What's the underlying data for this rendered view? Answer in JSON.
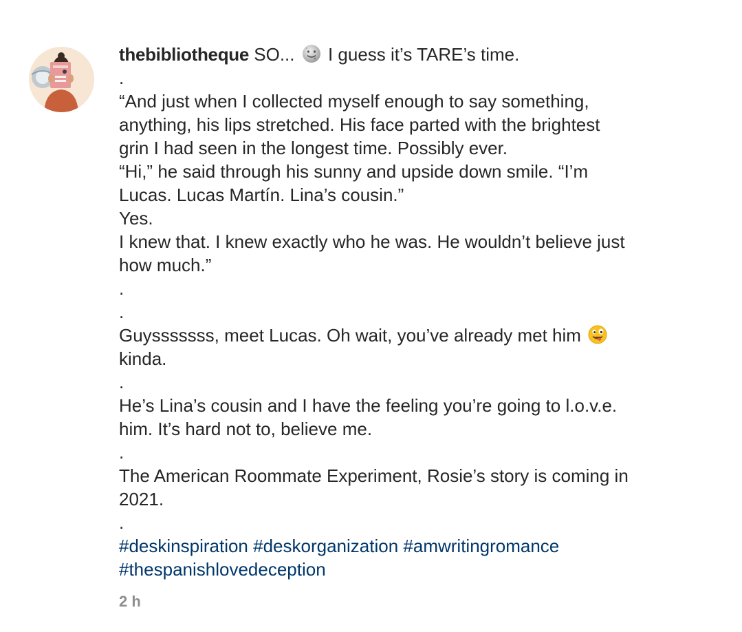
{
  "comment": {
    "username": "thebibliotheque",
    "first_line_pre_emoji": " SO... ",
    "first_line_post_emoji": " I guess it’s TARE’s time.",
    "emoji_1": "moon-face-icon",
    "emoji_2": "winking-tongue-face-icon",
    "lines": [
      ".",
      "“And just when I collected myself enough to say something,",
      "anything, his lips stretched. His face parted with the brightest",
      "grin I had seen in the longest time. Possibly ever.",
      "“Hi,” he said through his sunny and upside down smile. “I’m",
      "Lucas. Lucas Martín. Lina’s cousin.”",
      "Yes.",
      "I knew that. I knew exactly who he was. He wouldn’t believe just",
      "how much.”",
      ".",
      "."
    ],
    "guys_line_pre_emoji": "Guysssssss, meet Lucas. Oh wait, you’ve already met him ",
    "lines_after": [
      "kinda.",
      ".",
      "He’s Lina’s cousin and I have the feeling you’re going to l.o.v.e.",
      "him. It’s hard not to, believe me.",
      ".",
      "The American Roommate Experiment, Rosie’s story is coming in",
      "2021.",
      "."
    ],
    "hashtags_line_1": [
      "#deskinspiration",
      "#deskorganization",
      "#amwritingromance"
    ],
    "hashtags_line_2": [
      "#thespanishlovedeception"
    ],
    "timestamp": "2 h"
  },
  "colors": {
    "text": "#262626",
    "hashtag": "#00376b",
    "timestamp": "#8e8e8e"
  }
}
